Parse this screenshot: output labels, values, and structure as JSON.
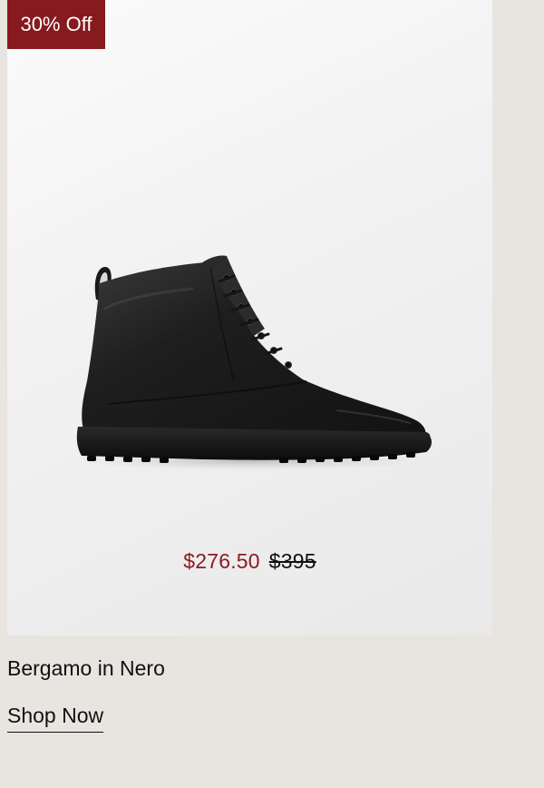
{
  "badge": {
    "label": "30% Off",
    "color": "#861a1e"
  },
  "product": {
    "image_icon": "black-lace-up-boot",
    "name": "Bergamo in Nero",
    "sale_price": "$276.50",
    "original_price": "$395",
    "sale_color": "#8c1c21"
  },
  "cta": {
    "label": "Shop Now"
  }
}
